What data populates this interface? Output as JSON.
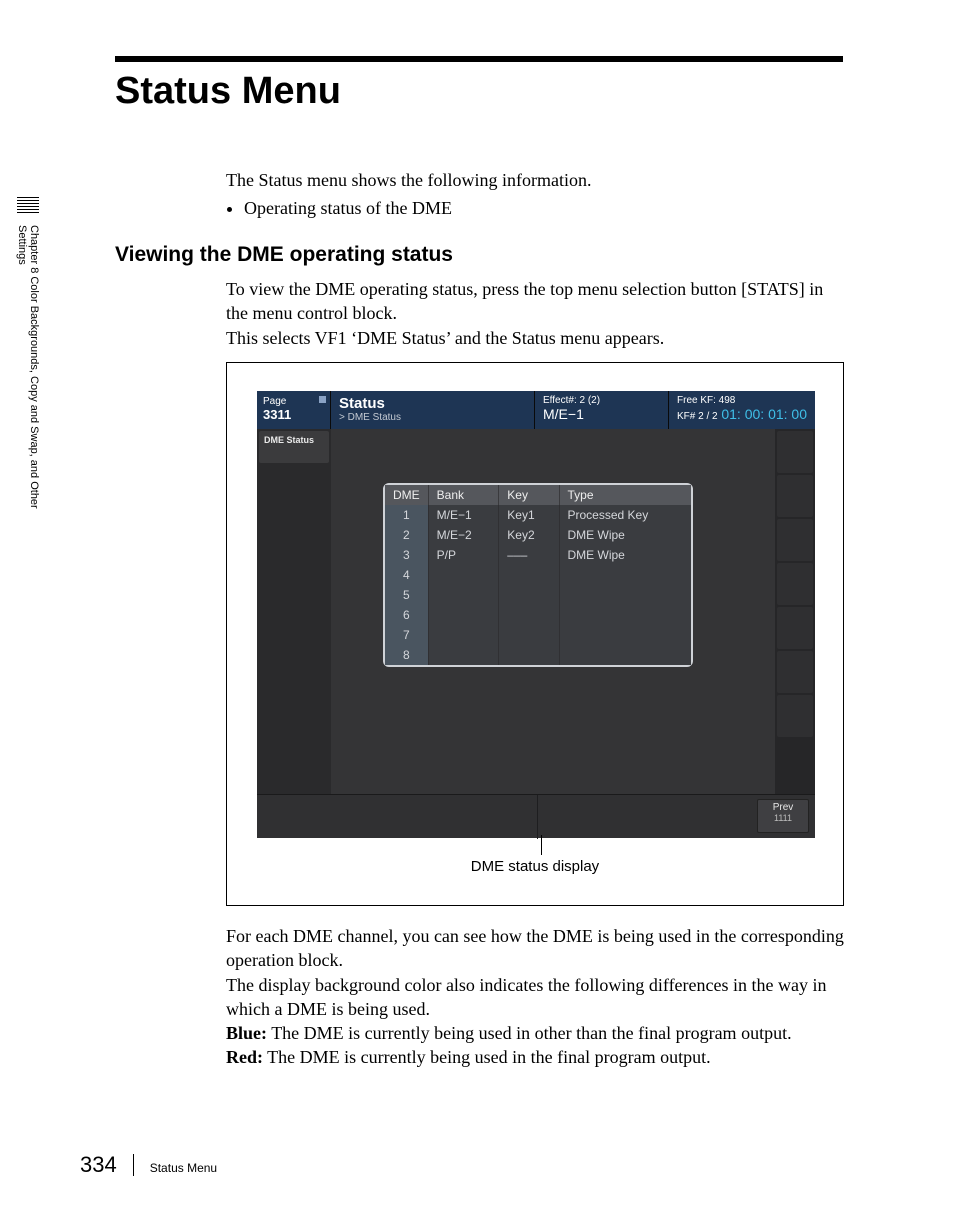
{
  "sidebar": {
    "chapter": "Chapter 8   Color Backgrounds, Copy and Swap, and Other Settings"
  },
  "title": "Status Menu",
  "intro": {
    "line": "The Status menu shows the following information.",
    "bullet1": "Operating status of the DME"
  },
  "h2": "Viewing the DME operating status",
  "para1": {
    "l1": "To view the DME operating status, press the top menu selection button [STATS] in the menu control block.",
    "l2": "This selects VF1 ‘DME Status’ and the Status menu appears."
  },
  "screen": {
    "page_label": "Page",
    "page_num": "3311",
    "menu_title": "Status",
    "breadcrumb": "> DME Status",
    "effect_label": "Effect#: 2 (2)",
    "me": "M/E−1",
    "kf_free": "Free KF: 498",
    "kf_pos": "KF# 2 / 2",
    "timecode": "01: 00: 01: 00",
    "tab1": "DME Status",
    "table": {
      "headers": {
        "c1": "DME",
        "c2": "Bank",
        "c3": "Key",
        "c4": "Type"
      },
      "rows": [
        {
          "dme": "1",
          "bank": "M/E−1",
          "key": "Key1",
          "type": "Processed Key"
        },
        {
          "dme": "2",
          "bank": "M/E−2",
          "key": "Key2",
          "type": "DME Wipe"
        },
        {
          "dme": "3",
          "bank": "P/P",
          "key": "–––",
          "type": "DME Wipe"
        },
        {
          "dme": "4",
          "bank": "",
          "key": "",
          "type": ""
        },
        {
          "dme": "5",
          "bank": "",
          "key": "",
          "type": ""
        },
        {
          "dme": "6",
          "bank": "",
          "key": "",
          "type": ""
        },
        {
          "dme": "7",
          "bank": "",
          "key": "",
          "type": ""
        },
        {
          "dme": "8",
          "bank": "",
          "key": "",
          "type": ""
        }
      ]
    },
    "prev_label": "Prev",
    "prev_num": "1111"
  },
  "fig_caption": "DME status display",
  "para2": {
    "l1": "For each DME channel, you can see how the DME is being used in the corresponding operation block.",
    "l2": "The display background color also indicates the following differences in the way in which a DME is being used.",
    "blue_label": "Blue:",
    "blue_text": " The DME is currently being used in other than the final program output.",
    "red_label": "Red:",
    "red_text": " The DME is currently being used in the final program output."
  },
  "footer": {
    "page": "334",
    "title": "Status Menu"
  }
}
